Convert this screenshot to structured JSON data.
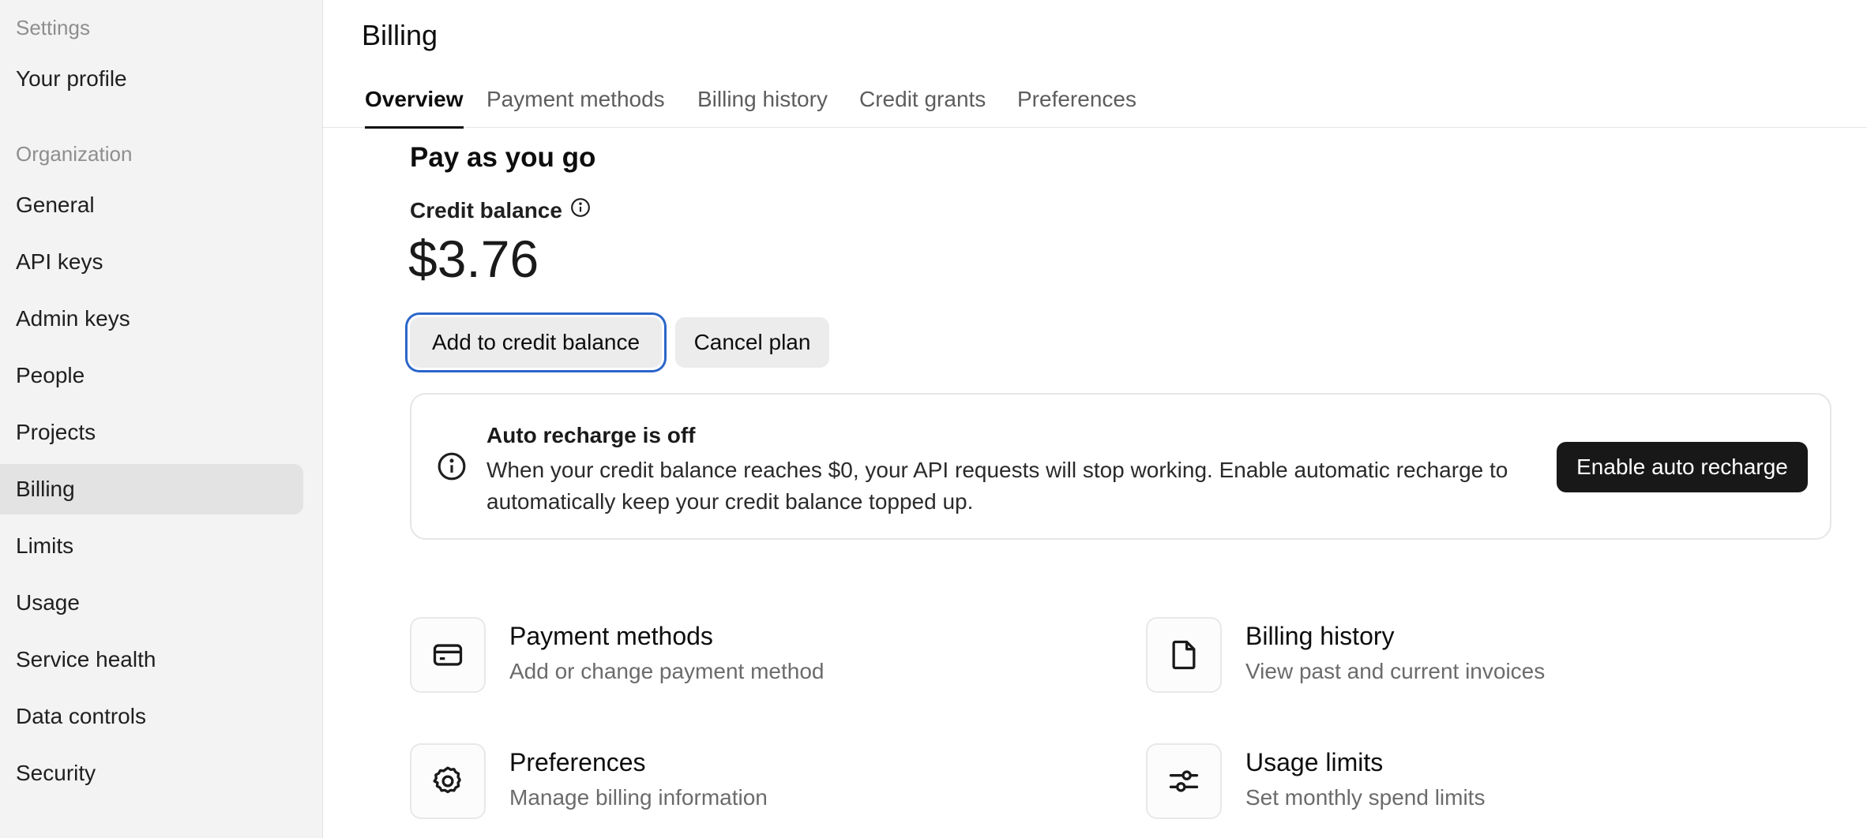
{
  "sidebar": {
    "settings_heading": "Settings",
    "profile": "Your profile",
    "org_heading": "Organization",
    "items": [
      {
        "label": "General"
      },
      {
        "label": "API keys"
      },
      {
        "label": "Admin keys"
      },
      {
        "label": "People"
      },
      {
        "label": "Projects"
      },
      {
        "label": "Billing",
        "active": true
      },
      {
        "label": "Limits"
      },
      {
        "label": "Usage"
      },
      {
        "label": "Service health"
      },
      {
        "label": "Data controls"
      },
      {
        "label": "Security"
      }
    ]
  },
  "header": {
    "title": "Billing"
  },
  "tabs": [
    {
      "label": "Overview",
      "active": true
    },
    {
      "label": "Payment methods"
    },
    {
      "label": "Billing history"
    },
    {
      "label": "Credit grants"
    },
    {
      "label": "Preferences"
    }
  ],
  "plan": {
    "title": "Pay as you go",
    "credit_label": "Credit balance",
    "balance": "$3.76",
    "add_button": "Add to credit balance",
    "cancel_button": "Cancel plan"
  },
  "banner": {
    "title": "Auto recharge is off",
    "text": "When your credit balance reaches $0, your API requests will stop working. Enable automatic recharge to automatically keep your credit balance topped up.",
    "button": "Enable auto recharge"
  },
  "cards": [
    {
      "title": "Payment methods",
      "subtitle": "Add or change payment method",
      "icon": "credit-card-icon"
    },
    {
      "title": "Billing history",
      "subtitle": "View past and current invoices",
      "icon": "document-icon"
    },
    {
      "title": "Preferences",
      "subtitle": "Manage billing information",
      "icon": "gear-icon"
    },
    {
      "title": "Usage limits",
      "subtitle": "Set monthly spend limits",
      "icon": "sliders-icon"
    }
  ],
  "colors": {
    "sidebar_bg": "#f3f3f3",
    "active_item_bg": "#e3e3e3",
    "focus_ring": "#2b66c9",
    "dark_button": "#181818"
  }
}
